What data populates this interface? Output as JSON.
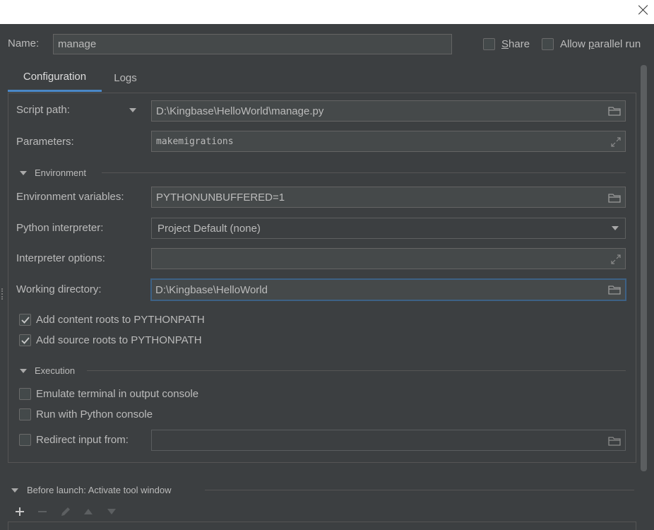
{
  "window": {
    "close_icon": "close-icon"
  },
  "name_row": {
    "label": "Name:",
    "value": "manage",
    "share_label": "Share",
    "share_mnemonic": "S",
    "share_rest": "hare",
    "parallel_pre": "Allow ",
    "parallel_mnemonic": "p",
    "parallel_rest": "arallel run"
  },
  "tabs": [
    {
      "label": "Configuration"
    },
    {
      "label": "Logs"
    }
  ],
  "config": {
    "script_path_label": "Script path:",
    "script_path_value": "D:\\Kingbase\\HelloWorld\\manage.py",
    "parameters_label": "Parameters:",
    "parameters_value": "makemigrations",
    "environment_section": "Environment",
    "env_vars_label": "Environment variables:",
    "env_vars_value": "PYTHONUNBUFFERED=1",
    "interpreter_label": "Python interpreter:",
    "interpreter_value": "Project Default (none)",
    "interpreter_options_label": "Interpreter options:",
    "interpreter_options_value": "",
    "working_dir_label": "Working directory:",
    "working_dir_value": "D:\\Kingbase\\HelloWorld",
    "add_content_roots_label": "Add content roots to PYTHONPATH",
    "add_content_roots_checked": true,
    "add_source_roots_label": "Add source roots to PYTHONPATH",
    "add_source_roots_checked": true,
    "execution_section": "Execution",
    "emulate_terminal_label": "Emulate terminal in output console",
    "run_python_console_label": "Run with Python console",
    "redirect_input_label": "Redirect input from:",
    "redirect_input_value": ""
  },
  "before_launch": {
    "label": "Before launch: Activate tool window"
  },
  "colors": {
    "background": "#3c3f41",
    "field": "#45494a",
    "accent": "#4a88c7",
    "focus": "#3d6185",
    "text": "#bbbbbb"
  }
}
